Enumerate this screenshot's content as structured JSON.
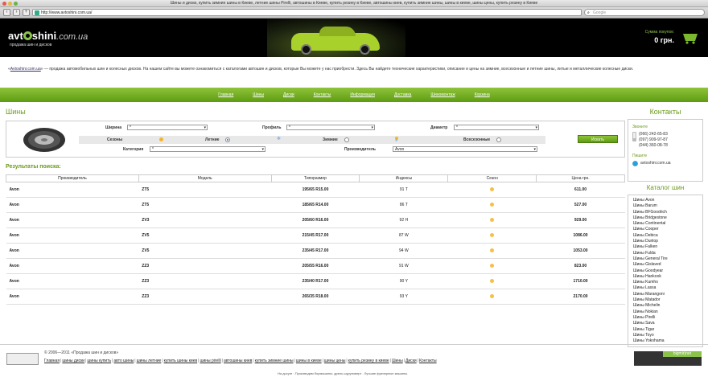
{
  "browser": {
    "title": "Шины и диски, купить зимние шины в Киеве, летние шины Pirelli, автошины в Киеве, купить резину в Киеве, автошины киев, купить зимние шины, шины в киеве, шины цены, купить резину в Киеве",
    "url": "http://www.avtoshini.com.ua/",
    "search_placeholder": "Google"
  },
  "header": {
    "logo_main": "avt",
    "logo_main2": "shini",
    "logo_domain": ".com.ua",
    "slogan": "продажа шин и дисков",
    "cart_label": "Сумма покупок:",
    "cart_sum": "0 грн."
  },
  "intro": {
    "link": "Avtoshini.com.ua",
    "text": " — продажа автомобильных шин и колесных дисков. На нашем сайте вы можете ознакомиться с каталогами автошин и дисков, которые Вы можете у нас приобрести. Здесь Вы найдете технические характеристики, описание и цены на зимние, всесезонные и летние шины, литые и металлические колесные диски."
  },
  "nav": [
    "Главная",
    "Шины",
    "Диски",
    "Контакты",
    "Информация",
    "Доставка",
    "Шиномонтаж",
    "Корзина"
  ],
  "filter": {
    "section_title": "Шины",
    "width_label": "Ширина",
    "width_value": "*",
    "profile_label": "Профиль",
    "profile_value": "*",
    "diameter_label": "Диаметр",
    "diameter_value": "*",
    "seasons_label": "Сезоны",
    "summer_label": "Летние",
    "winter_label": "Зимние",
    "allseason_label": "Всесезонные",
    "category_label": "Категория",
    "category_value": "*",
    "manufacturer_label": "Производитель",
    "manufacturer_value": "Avon",
    "search_button": "Искать"
  },
  "results": {
    "title": "Результаты поиска:",
    "headers": [
      "Производитель",
      "Модель",
      "Типоразмер",
      "Индексы",
      "Сезон",
      "Цена грн."
    ],
    "rows": [
      {
        "mfr": "Avon",
        "model": "ZT5",
        "size": "195/65 R15.00",
        "idx": "91 T",
        "price": "611.00"
      },
      {
        "mfr": "Avon",
        "model": "ZT5",
        "size": "185/65 R14.00",
        "idx": "86 T",
        "price": "527.00"
      },
      {
        "mfr": "Avon",
        "model": "ZV3",
        "size": "205/60 R16.00",
        "idx": "92 H",
        "price": "929.00"
      },
      {
        "mfr": "Avon",
        "model": "ZV5",
        "size": "215/45 R17.00",
        "idx": "87 W",
        "price": "1086.00"
      },
      {
        "mfr": "Avon",
        "model": "ZV5",
        "size": "235/45 R17.00",
        "idx": "94 W",
        "price": "1053.00"
      },
      {
        "mfr": "Avon",
        "model": "ZZ3",
        "size": "205/55 R16.00",
        "idx": "91 W",
        "price": "823.00"
      },
      {
        "mfr": "Avon",
        "model": "ZZ3",
        "size": "235/40 R17.00",
        "idx": "90 Y",
        "price": "1710.00"
      },
      {
        "mfr": "Avon",
        "model": "ZZ3",
        "size": "265/35 R18.00",
        "idx": "93 Y",
        "price": "2170.00"
      }
    ]
  },
  "contacts": {
    "title": "Контакты",
    "call_label": "Звоните",
    "phones": [
      "(066) 242-65-83",
      "(097) 909-97-87",
      "(044) 360-08-78"
    ],
    "write_label": "Пишите",
    "email": "avtoshini.com.ua"
  },
  "catalog": {
    "title": "Каталог шин",
    "items": [
      "Шины Avon",
      "Шины Barum",
      "Шины BFGoodrich",
      "Шины Bridgestone",
      "Шины Continental",
      "Шины Cooper",
      "Шины Debica",
      "Шины Dunlop",
      "Шины Falken",
      "Шины Fulda",
      "Шины General Tire",
      "Шины Gislaved",
      "Шины Goodyear",
      "Шины Hankook",
      "Шины Kumho",
      "Шины Lassa",
      "Шины Marangoni",
      "Шины Matador",
      "Шины Michelin",
      "Шины Nokian",
      "Шины Pirelli",
      "Шины Sava",
      "Шины Tigar",
      "Шины Toyo",
      "Шины Yokohama"
    ]
  },
  "footer": {
    "copyright": "© 2006—2011 «Продажа шин и дисков»",
    "links": [
      "Главная",
      "шины диски",
      "шины купить",
      "авто шины",
      "шины летние",
      "купить шины киев",
      "шины pirelli",
      "автошины киев",
      "купить зимние шины",
      "шины в киеве",
      "шины цены",
      "купить резину в киеве",
      "Шины",
      "Диски",
      "Контакты"
    ],
    "tagline": "На досуге : Производим бормашины; дрель шуруповерт . Лучшие фрезерные машины.",
    "bigmir": "bigmir)net"
  }
}
